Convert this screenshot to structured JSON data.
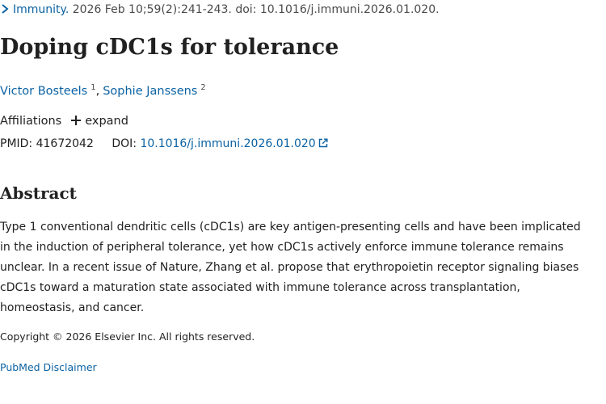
{
  "citation": {
    "journal": "Immunity.",
    "details": " 2026 Feb 10;59(2):241-243. doi: 10.1016/j.immuni.2026.01.020."
  },
  "article": {
    "title": "Doping cDC1s for tolerance",
    "authors": [
      {
        "name": "Victor Bosteels",
        "aff": "1"
      },
      {
        "name": "Sophie Janssens",
        "aff": "2"
      }
    ],
    "author_separator": ",",
    "affiliations_label": "Affiliations",
    "expand_label": "expand",
    "pmid_label": "PMID:",
    "pmid": "41672042",
    "doi_label": "DOI:",
    "doi": "10.1016/j.immuni.2026.01.020"
  },
  "abstract": {
    "heading": "Abstract",
    "lines": [
      "Type 1 conventional dendritic cells (cDC1s) are key antigen-presenting cells and have been implicated",
      "in the induction of peripheral tolerance, yet how cDC1s actively enforce immune tolerance remains",
      "unclear. In a recent issue of Nature, Zhang et al. propose that erythropoietin receptor signaling biases",
      "cDC1s toward a maturation state associated with immune tolerance across transplantation,",
      "homeostasis, and cancer."
    ]
  },
  "footer": {
    "copyright": "Copyright © 2026 Elsevier Inc. All rights reserved.",
    "disclaimer": "PubMed Disclaimer"
  },
  "icons": {
    "citation_toggle": "chevron-right-icon",
    "affiliations_expand": "plus-icon",
    "doi_external": "external-link-icon"
  },
  "colors": {
    "link": "#0b62a3",
    "text": "#212121"
  }
}
